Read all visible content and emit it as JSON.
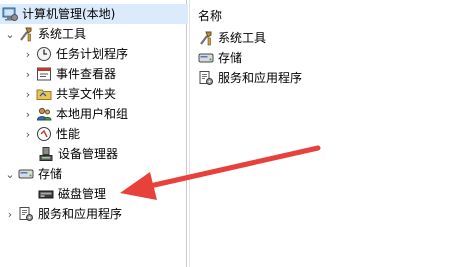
{
  "tree": {
    "root_label": "计算机管理(本地)",
    "system_tools_label": "系统工具",
    "system_tools_children": [
      {
        "label": "任务计划程序",
        "icon": "clock-icon"
      },
      {
        "label": "事件查看器",
        "icon": "event-viewer-icon"
      },
      {
        "label": "共享文件夹",
        "icon": "shared-folder-icon"
      },
      {
        "label": "本地用户和组",
        "icon": "users-icon"
      },
      {
        "label": "性能",
        "icon": "performance-icon"
      },
      {
        "label": "设备管理器",
        "icon": "device-manager-icon"
      }
    ],
    "storage_label": "存储",
    "disk_management_label": "磁盘管理",
    "services_label": "服务和应用程序"
  },
  "list": {
    "column_header": "名称",
    "items": [
      {
        "label": "系统工具",
        "icon": "tools-icon"
      },
      {
        "label": "存储",
        "icon": "storage-icon"
      },
      {
        "label": "服务和应用程序",
        "icon": "services-icon"
      }
    ]
  },
  "colors": {
    "annotation_arrow": "#e8403a",
    "selection": "#dcebfc"
  }
}
